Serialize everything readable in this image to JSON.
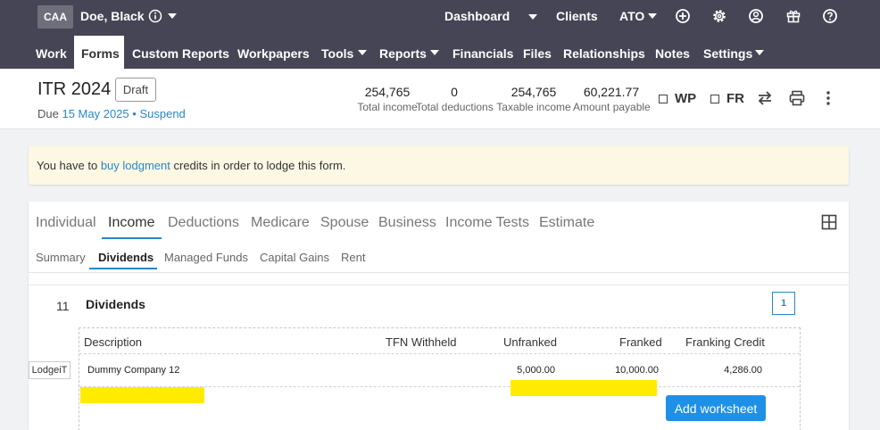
{
  "topbar": {
    "org_badge": "CAA",
    "client_name": "Doe, Black",
    "nav": {
      "dashboard": "Dashboard",
      "clients": "Clients",
      "ato": "ATO"
    },
    "icons": [
      "info-icon",
      "plus-circle-icon",
      "gear-icon",
      "user-circle-icon",
      "gift-icon",
      "help-icon"
    ]
  },
  "menu": {
    "items": [
      "Work",
      "Forms",
      "Custom Reports",
      "Workpapers",
      "Tools",
      "Reports",
      "Financials",
      "Files",
      "Relationships",
      "Notes",
      "Settings"
    ],
    "active": "Forms"
  },
  "form": {
    "title": "ITR 2024",
    "status": "Draft",
    "due_prefix": "Due",
    "due_date": "15 May 2025",
    "bullet": "•",
    "suspend": "Suspend",
    "stats": [
      {
        "value": "254,765",
        "label": "Total income"
      },
      {
        "value": "0",
        "label": "Total deductions"
      },
      {
        "value": "254,765",
        "label": "Taxable income"
      },
      {
        "value": "60,221.77",
        "label": "Amount payable"
      }
    ],
    "checks": {
      "wp": "WP",
      "fr": "FR"
    }
  },
  "banner": {
    "before": "You have to ",
    "link": "buy lodgment",
    "after": " credits in order to lodge this form."
  },
  "tabs": {
    "main": [
      "Individual",
      "Income",
      "Deductions",
      "Medicare",
      "Spouse",
      "Business",
      "Income Tests",
      "Estimate"
    ],
    "active_main": "Income",
    "sub": [
      "Summary",
      "Dividends",
      "Managed Funds",
      "Capital Gains",
      "Rent"
    ],
    "active_sub": "Dividends"
  },
  "section": {
    "number": "11",
    "title": "Dividends",
    "count": "1",
    "tag": "LodgeiT",
    "columns": {
      "description": "Description",
      "tfn": "TFN Withheld",
      "unfranked": "Unfranked",
      "franked": "Franked",
      "credit": "Franking Credit"
    },
    "rows": [
      {
        "description": "Dummy Company 12",
        "tfn": "",
        "unfranked": "5,000.00",
        "franked": "10,000.00",
        "credit": "4,286.00"
      }
    ],
    "add_worksheet": "Add worksheet"
  },
  "colors": {
    "topbar": "#464555",
    "accent": "#2a86c6",
    "button": "#1e90e8",
    "highlight": "#ffeb00",
    "banner": "#fdf8e4"
  }
}
